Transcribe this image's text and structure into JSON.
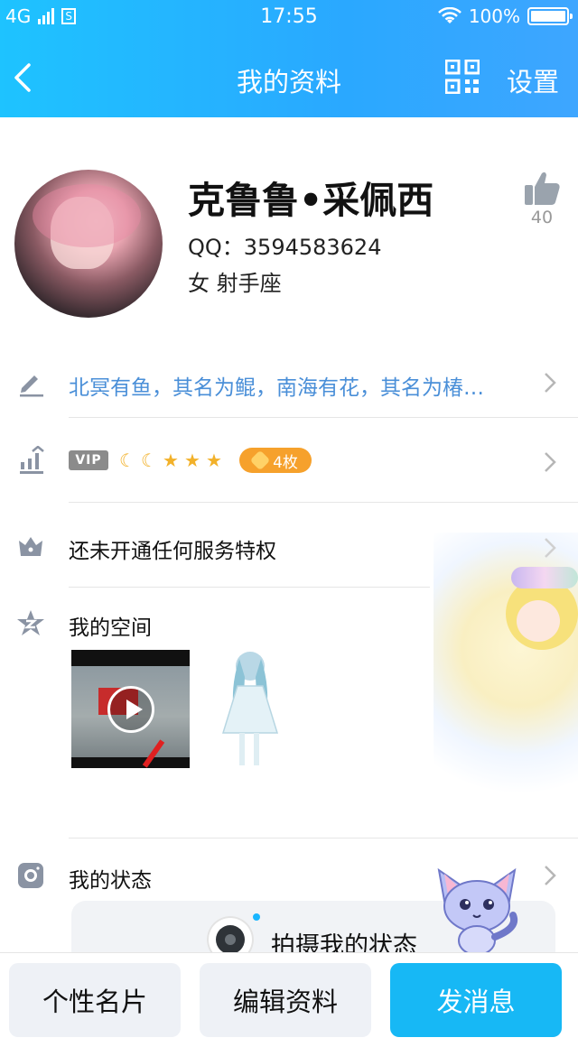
{
  "status_bar": {
    "network": "4G",
    "time": "17:55",
    "battery": "100%",
    "sim_label": "S",
    "battery_level": 1.0
  },
  "nav": {
    "title": "我的资料",
    "settings": "设置",
    "icons": {
      "back": "back-chevron-icon",
      "qr": "qr-code-icon"
    }
  },
  "profile": {
    "name": "克鲁鲁•采佩西",
    "qq": "QQ：3594583624",
    "gender_sign": "女  射手座",
    "likes": "40"
  },
  "rows": {
    "signature": "北冥有鱼，其名为鲲，南海有花，其名为椿…",
    "vip_badge": "VIP",
    "medal_count": "4枚",
    "privilege": "还未开通任何服务特权",
    "space": "我的空间",
    "status": "我的状态",
    "status_cta": "拍摄我的状态"
  },
  "level_icons": [
    "moon",
    "moon",
    "star",
    "star",
    "star"
  ],
  "bottom_bar": {
    "card": "个性名片",
    "edit": "编辑资料",
    "message": "发消息"
  },
  "colors": {
    "header": "#1ec3ff",
    "accent": "#17b8f5",
    "signature": "#4a8fd8",
    "medal": "#f6a12c"
  }
}
